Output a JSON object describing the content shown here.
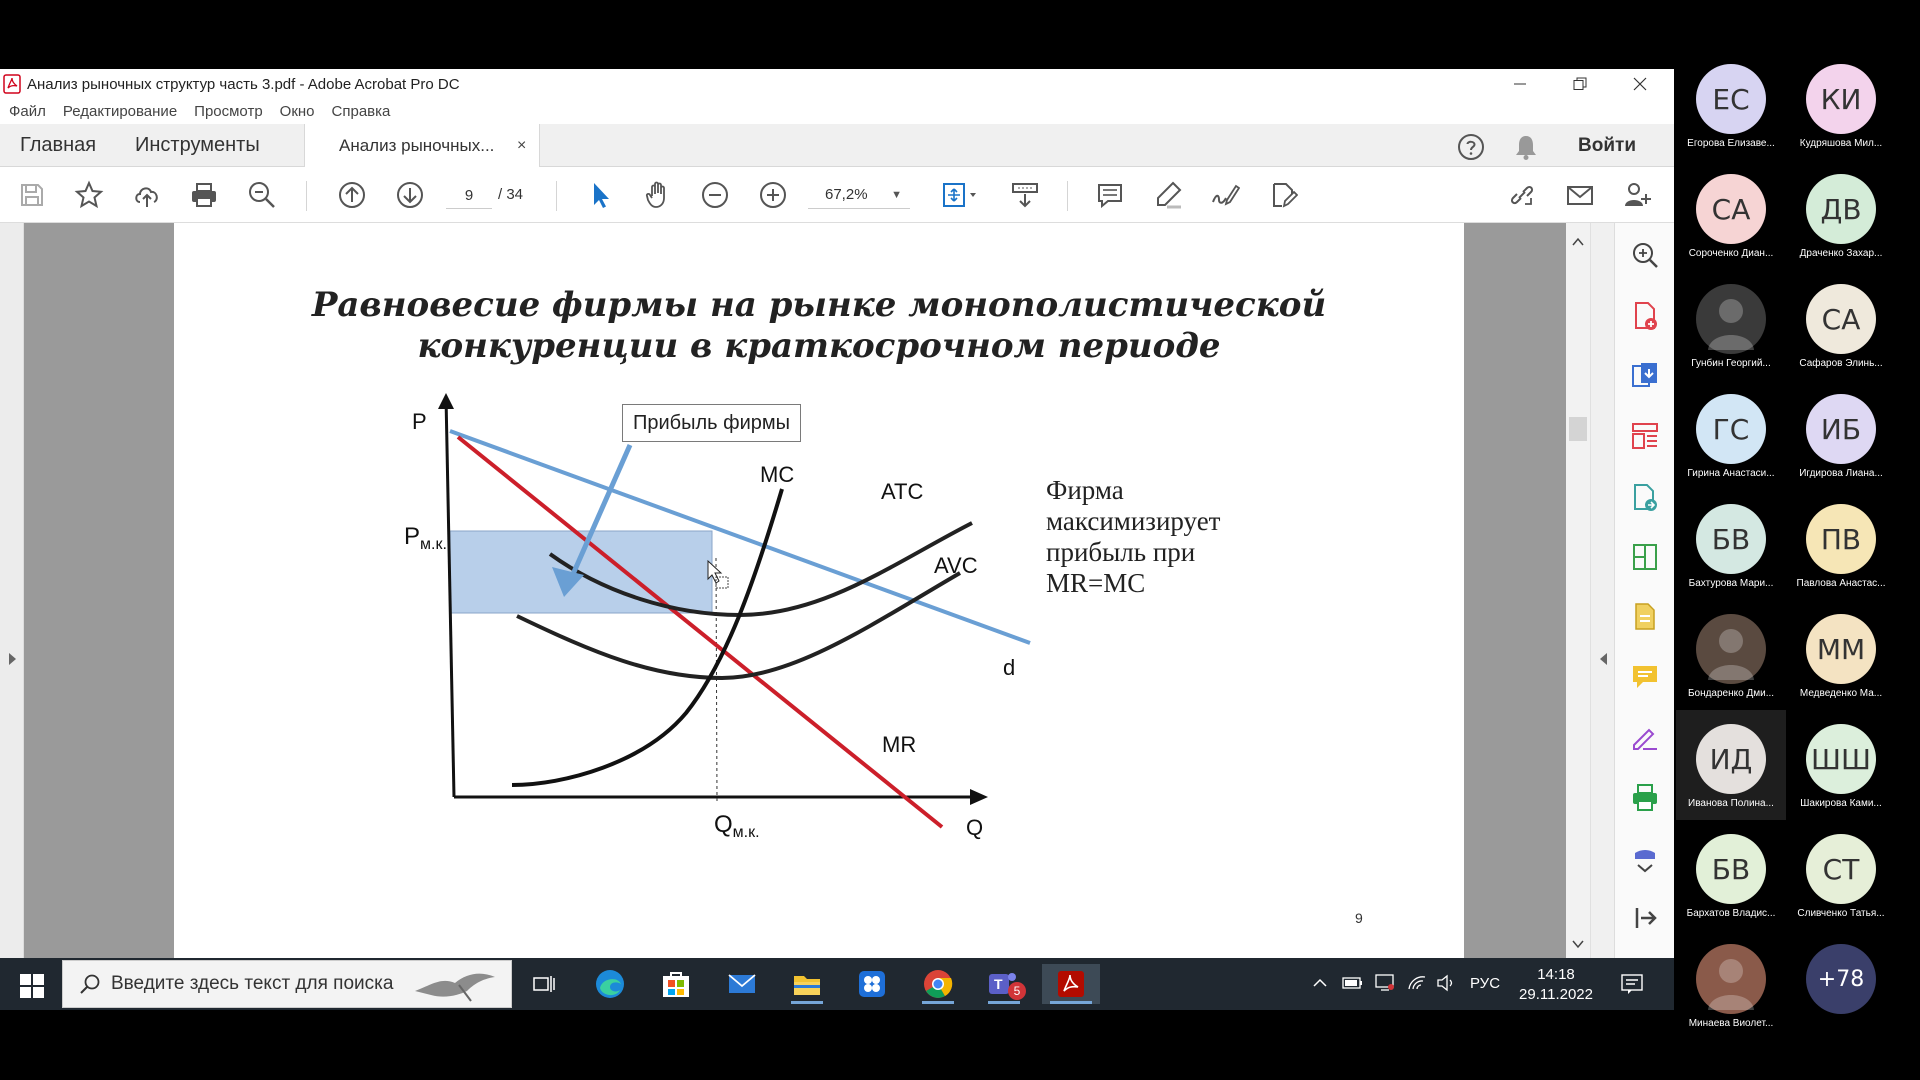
{
  "window": {
    "title": "Анализ рыночных структур часть 3.pdf - Adobe Acrobat Pro DC"
  },
  "menu": [
    "Файл",
    "Редактирование",
    "Просмотр",
    "Окно",
    "Справка"
  ],
  "tabs": {
    "home": "Главная",
    "tools": "Инструменты",
    "document": "Анализ рыночных...",
    "close": "×",
    "signin": "Войти"
  },
  "toolbar": {
    "page_current": "9",
    "page_total": "/ 34",
    "zoom": "67,2%"
  },
  "slide": {
    "title_line1": "Равновесие фирмы на рынке монополистической",
    "title_line2": "конкуренции в краткосрочном периоде",
    "profit_box": "Прибыль фирмы",
    "side_text": [
      "Фирма",
      "максимизирует",
      "прибыль при",
      "MR=MC"
    ],
    "axis_p": "P",
    "axis_q": "Q",
    "p_label": "P",
    "p_sub": "м.к.",
    "q_label": "Q",
    "q_sub": "м.к.",
    "curve_mc": "MC",
    "curve_atc": "ATC",
    "curve_avc": "AVC",
    "curve_d": "d",
    "curve_mr": "MR",
    "page_number": "9"
  },
  "taskbar": {
    "search_placeholder": "Введите здесь текст для поиска",
    "teams_badge": "5",
    "lang": "РУС",
    "time": "14:18",
    "date": "29.11.2022"
  },
  "participants": [
    {
      "initials": "ЕС",
      "name": "Егорова Елизаве...",
      "color": "#d7d4f2"
    },
    {
      "initials": "КИ",
      "name": "Кудряшова Мил...",
      "color": "#f3d3ec"
    },
    {
      "initials": "СА",
      "name": "Сороченко Диан...",
      "color": "#f6d4d4"
    },
    {
      "initials": "ДВ",
      "name": "Драченко Захар...",
      "color": "#d4ecd8"
    },
    {
      "initials": "",
      "name": "Гунбин Георгий...",
      "color": "#3a3a3a"
    },
    {
      "initials": "СА",
      "name": "Сафаров Элинь...",
      "color": "#efe9dc"
    },
    {
      "initials": "ГС",
      "name": "Гирина Анастаси...",
      "color": "#d2e6f5"
    },
    {
      "initials": "ИБ",
      "name": "Игдирова Лиана...",
      "color": "#ded8f3"
    },
    {
      "initials": "БВ",
      "name": "Бахтурова Мари...",
      "color": "#d4e8e2"
    },
    {
      "initials": "ПВ",
      "name": "Павлова Анастас...",
      "color": "#f6e6b6"
    },
    {
      "initials": "",
      "name": "Бондаренко Дми...",
      "color": "#5a4a40"
    },
    {
      "initials": "ММ",
      "name": "Медведенко Ма...",
      "color": "#f4e3c2"
    },
    {
      "initials": "ИД",
      "name": "Иванова Полина...",
      "color": "#e4e0dd"
    },
    {
      "initials": "ШШ",
      "name": "Шакирова Ками...",
      "color": "#dcefdc"
    },
    {
      "initials": "БВ",
      "name": "Бархатов Владис...",
      "color": "#e2f0d8"
    },
    {
      "initials": "СТ",
      "name": "Сливченко Татья...",
      "color": "#e6efd8"
    },
    {
      "initials": "",
      "name": "Минаева Виолет...",
      "color": "#8a5a4a"
    },
    {
      "initials": "+78",
      "name": "",
      "color": "#3a3f6a"
    }
  ]
}
